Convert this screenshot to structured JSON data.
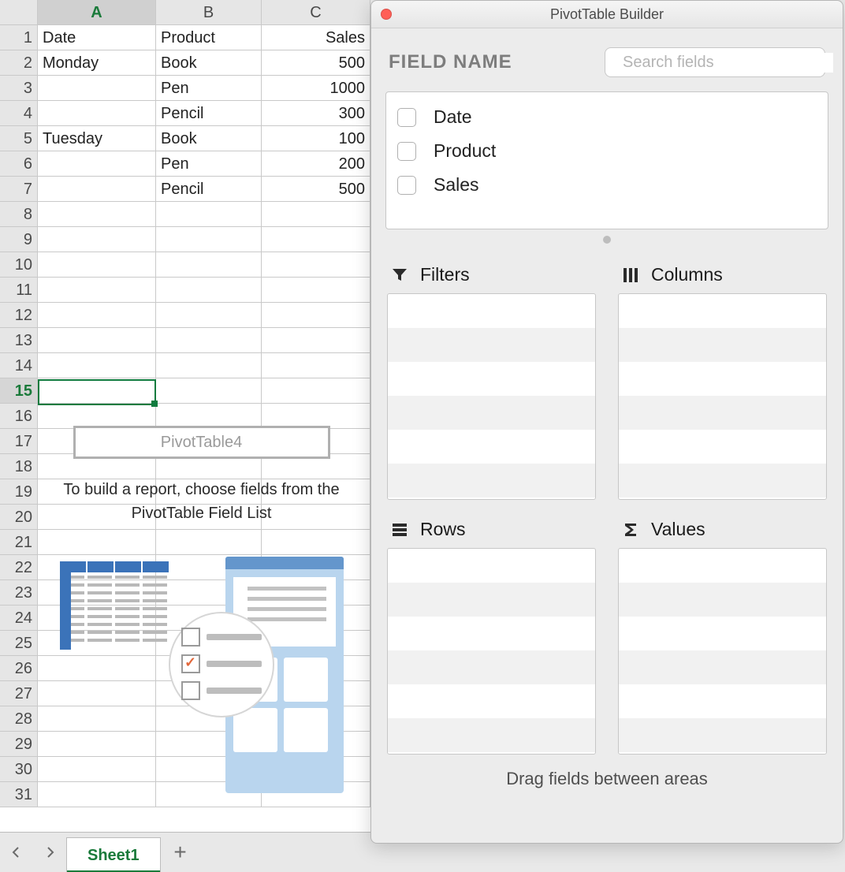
{
  "spreadsheet": {
    "columns": [
      "A",
      "B",
      "C"
    ],
    "active_column": "A",
    "active_row": 15,
    "row_count": 31,
    "rows": [
      {
        "A": "Date",
        "B": "Product",
        "C": "Sales"
      },
      {
        "A": "Monday",
        "B": "Book",
        "C": "500"
      },
      {
        "A": "",
        "B": "Pen",
        "C": "1000"
      },
      {
        "A": "",
        "B": "Pencil",
        "C": "300"
      },
      {
        "A": "Tuesday",
        "B": "Book",
        "C": "100"
      },
      {
        "A": "",
        "B": "Pen",
        "C": "200"
      },
      {
        "A": "",
        "B": "Pencil",
        "C": "500"
      }
    ],
    "pivot_overlay": {
      "name": "PivotTable4",
      "instruction": "To build a report, choose fields from the PivotTable Field List"
    },
    "tab": "Sheet1"
  },
  "builder": {
    "title": "PivotTable Builder",
    "field_name_label": "FIELD NAME",
    "search_placeholder": "Search fields",
    "fields": [
      "Date",
      "Product",
      "Sales"
    ],
    "zones": {
      "filters": "Filters",
      "columns": "Columns",
      "rows": "Rows",
      "values": "Values"
    },
    "drag_hint": "Drag fields between areas"
  }
}
